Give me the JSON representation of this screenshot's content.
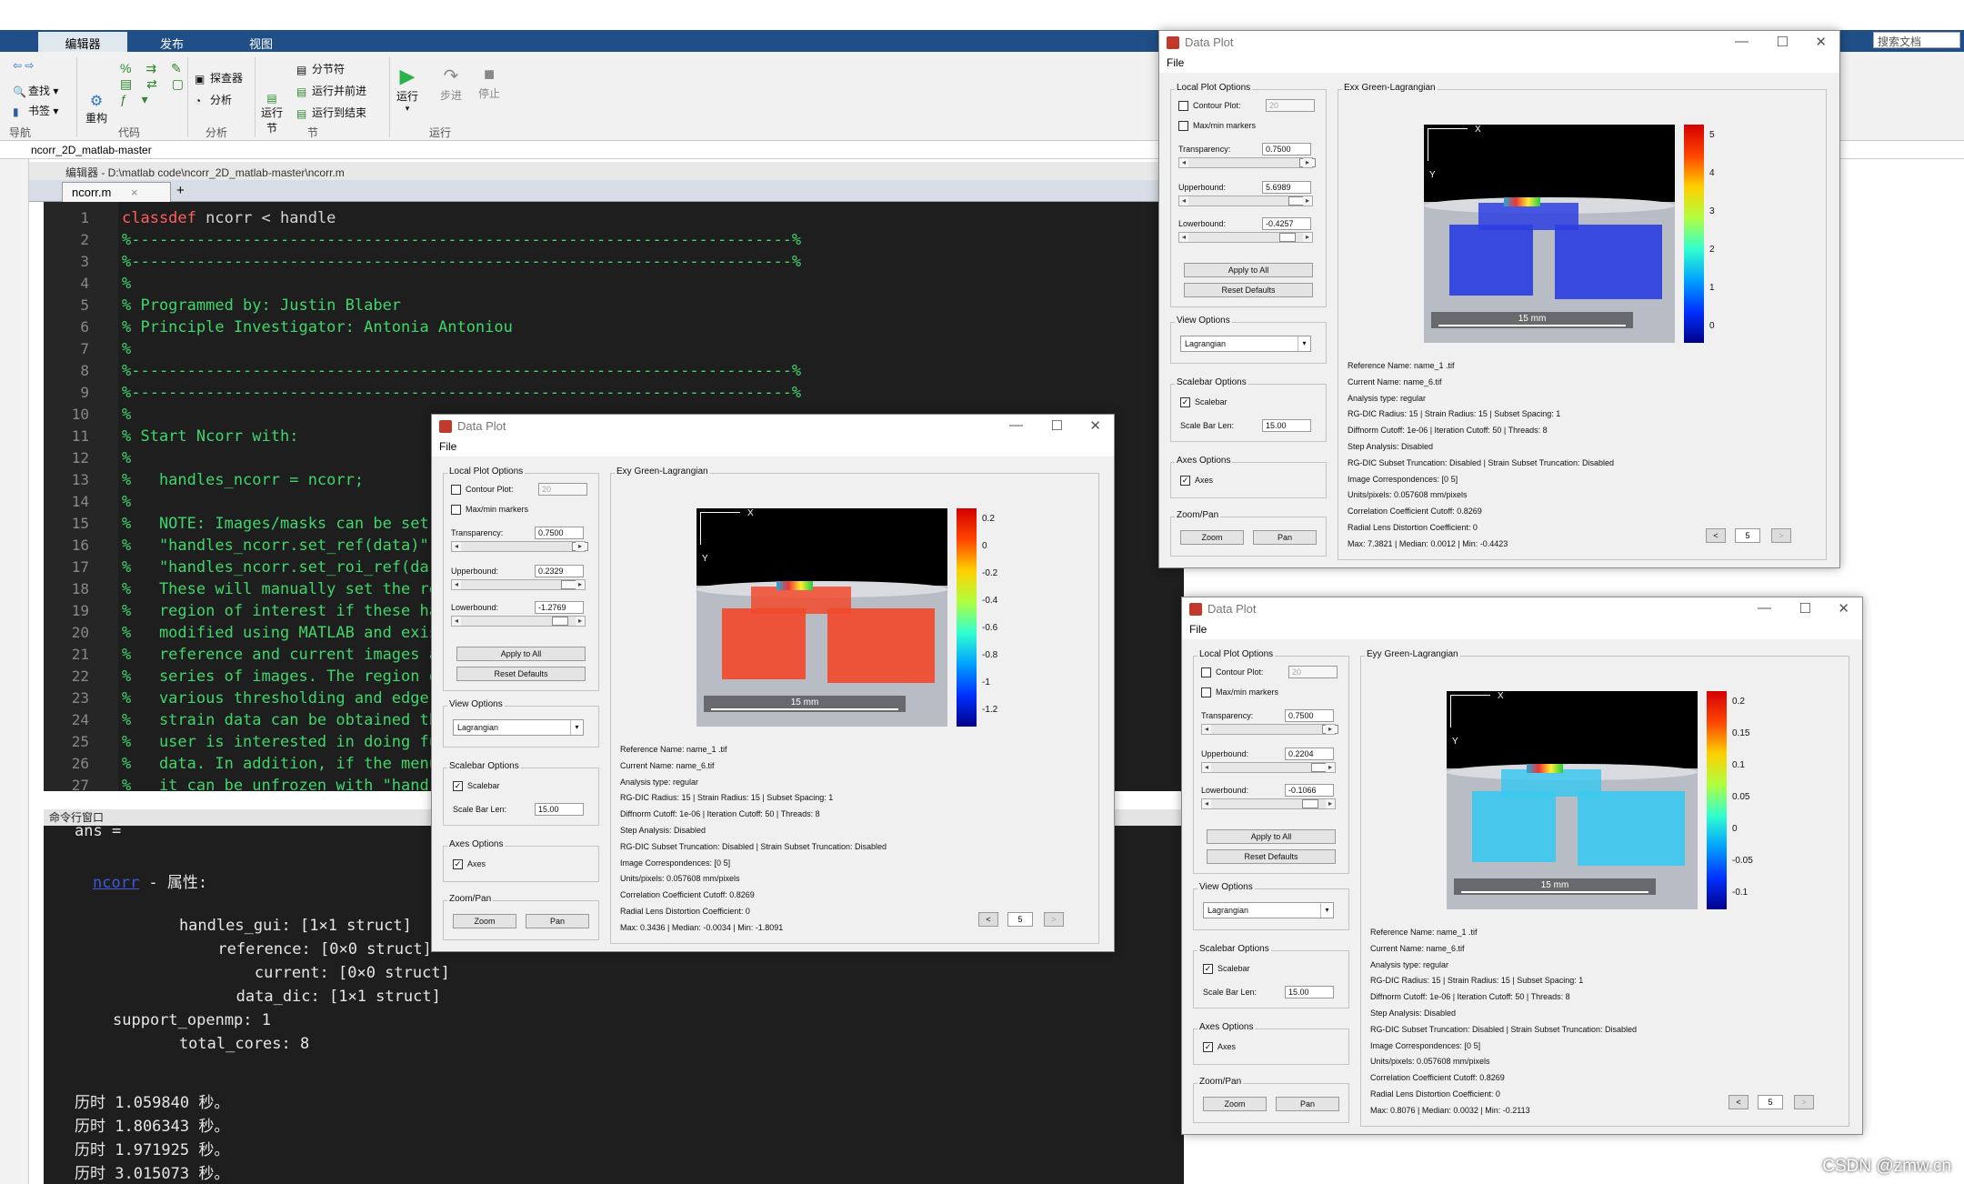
{
  "app": {
    "tabs": [
      "编辑器",
      "发布",
      "视图"
    ],
    "ribbon": {
      "navigate": {
        "find": "查找",
        "bookmark": "书签",
        "group": "导航"
      },
      "code": {
        "refactor": "重构",
        "group": "代码"
      },
      "analyze": {
        "explorer": "探查器",
        "analyze": "分析",
        "group": "分析"
      },
      "section": {
        "run_section": "运行节",
        "section_break": "分节符",
        "run_advance": "运行并前进",
        "run_to_end": "运行到结束",
        "group": "节"
      },
      "run": {
        "run": "运行",
        "step": "步进",
        "stop": "停止",
        "group": "运行"
      },
      "search_placeholder": "搜索文档"
    },
    "path": "ncorr_2D_matlab-master",
    "editor_title": "编辑器 - D:\\matlab code\\ncorr_2D_matlab-master\\ncorr.m",
    "file_tab": "ncorr.m",
    "file_tab_close": "×",
    "new_tab": "+",
    "cmd_title": "命令行窗口"
  },
  "code_lines": [
    {
      "n": "1",
      "kw": "classdef",
      "text": " ncorr < handle"
    },
    {
      "n": "2",
      "cmt": "%-----------------------------------------------------------------------%"
    },
    {
      "n": "3",
      "cmt": "%-----------------------------------------------------------------------%"
    },
    {
      "n": "4",
      "cmt": "%"
    },
    {
      "n": "5",
      "cmt": "% Programmed by: Justin Blaber"
    },
    {
      "n": "6",
      "cmt": "% Principle Investigator: Antonia Antoniou"
    },
    {
      "n": "7",
      "cmt": "%"
    },
    {
      "n": "8",
      "cmt": "%-----------------------------------------------------------------------%"
    },
    {
      "n": "9",
      "cmt": "%-----------------------------------------------------------------------%"
    },
    {
      "n": "10",
      "cmt": "%"
    },
    {
      "n": "11",
      "cmt": "% Start Ncorr with:"
    },
    {
      "n": "12",
      "cmt": "%"
    },
    {
      "n": "13",
      "cmt": "%   handles_ncorr = ncorr;"
    },
    {
      "n": "14",
      "cmt": "%"
    },
    {
      "n": "15",
      "cmt": "%   NOTE: Images/masks can be set"
    },
    {
      "n": "16",
      "cmt": "%   \"handles_ncorr.set_ref(data)\""
    },
    {
      "n": "17",
      "cmt": "%   \"handles_ncorr.set_roi_ref(da"
    },
    {
      "n": "18",
      "cmt": "%   These will manually set the re"
    },
    {
      "n": "19",
      "cmt": "%   region of interest if these ha"
    },
    {
      "n": "20",
      "cmt": "%   modified using MATLAB and exis"
    },
    {
      "n": "21",
      "cmt": "%   reference and current images a"
    },
    {
      "n": "22",
      "cmt": "%   series of images. The region o"
    },
    {
      "n": "23",
      "cmt": "%   various thresholding and edge"
    },
    {
      "n": "24",
      "cmt": "%   strain data can be obtained th"
    },
    {
      "n": "25",
      "cmt": "%   user is interested in doing fu"
    },
    {
      "n": "26",
      "cmt": "%   data. In addition, if the menu"
    },
    {
      "n": "27",
      "cmt": "%   it can be unfrozen with \"hand"
    }
  ],
  "cmd_lines": [
    {
      "text": "ans ="
    },
    {
      "link": "ncorr",
      "text": " - 属性:"
    },
    {
      "text": "    handles_gui: [1×1 struct]"
    },
    {
      "text": "      reference: [0×0 struct]"
    },
    {
      "text": "        current: [0×0 struct]"
    },
    {
      "text": "       data_dic: [1×1 struct]"
    },
    {
      "text": "support_openmp: 1"
    },
    {
      "text": "    total_cores: 8"
    },
    {
      "text": "历时 1.059840 秒。"
    },
    {
      "text": "历时 1.806343 秒。"
    },
    {
      "text": "历时 1.971925 秒。"
    },
    {
      "text": "历时 3.015073 秒。"
    }
  ],
  "common_plot": {
    "window_title": "Data Plot",
    "menu": "File",
    "local_options": "Local Plot Options",
    "contour_label": "Contour Plot:",
    "contour_value": "20",
    "maxmin_label": "Max/min markers",
    "transparency_label": "Transparency:",
    "upperbound_label": "Upperbound:",
    "lowerbound_label": "Lowerbound:",
    "apply_all": "Apply to All",
    "reset": "Reset Defaults",
    "view_options": "View Options",
    "view_value": "Lagrangian",
    "scalebar_options": "Scalebar Options",
    "scalebar_label": "Scalebar",
    "scalebar_len_label": "Scale Bar Len:",
    "scalebar_len": "15.00",
    "axes_options": "Axes Options",
    "axes_label": "Axes",
    "zoompan": "Zoom/Pan",
    "zoom": "Zoom",
    "pan": "Pan",
    "scale_text": "15 mm",
    "x_label": "X",
    "y_label": "Y",
    "page": "5",
    "prev": "<",
    "next": ">",
    "info": [
      "Reference Name: name_1 .tif",
      "Current Name: name_6.tif",
      "Analysis type: regular",
      "RG-DIC Radius: 15 | Strain Radius: 15 | Subset Spacing: 1",
      "Diffnorm Cutoff: 1e-06 | Iteration Cutoff: 50 | Threads: 8",
      "Step Analysis: Disabled",
      "RG-DIC Subset Truncation: Disabled | Strain Subset Truncation: Disabled",
      "Image Correspondences: [0 5]",
      "Units/pixels: 0.057608 mm/pixels",
      "Correlation Coefficient Cutoff: 0.8269",
      "Radial Lens Distortion Coefficient: 0"
    ]
  },
  "plots": [
    {
      "id": "exx",
      "title": "Exx Green-Lagrangian",
      "transparency": "0.7500",
      "upperbound": "5.6989",
      "lowerbound": "-0.4257",
      "stats": "Max: 7.3821 | Median: 0.0012 | Min: -0.4423",
      "ticks": [
        "5",
        "4",
        "3",
        "2",
        "1",
        "0"
      ],
      "field_color": "#2d3fe0"
    },
    {
      "id": "exy",
      "title": "Exy Green-Lagrangian",
      "transparency": "0.7500",
      "upperbound": "0.2329",
      "lowerbound": "-1.2769",
      "stats": "Max: 0.3436 | Median: -0.0034 | Min: -1.8091",
      "ticks": [
        "0.2",
        "0",
        "-0.2",
        "-0.4",
        "-0.6",
        "-0.8",
        "-1",
        "-1.2"
      ],
      "field_color": "#f14a2c"
    },
    {
      "id": "eyy",
      "title": "Eyy Green-Lagrangian",
      "transparency": "0.7500",
      "upperbound": "0.2204",
      "lowerbound": "-0.1066",
      "stats": "Max: 0.8076 | Median: 0.0032 | Min: -0.2113",
      "ticks": [
        "0.2",
        "0.15",
        "0.1",
        "0.05",
        "0",
        "-0.05",
        "-0.1"
      ],
      "field_color": "#3cc8ee"
    }
  ],
  "watermark": "CSDN @zmw.cn"
}
